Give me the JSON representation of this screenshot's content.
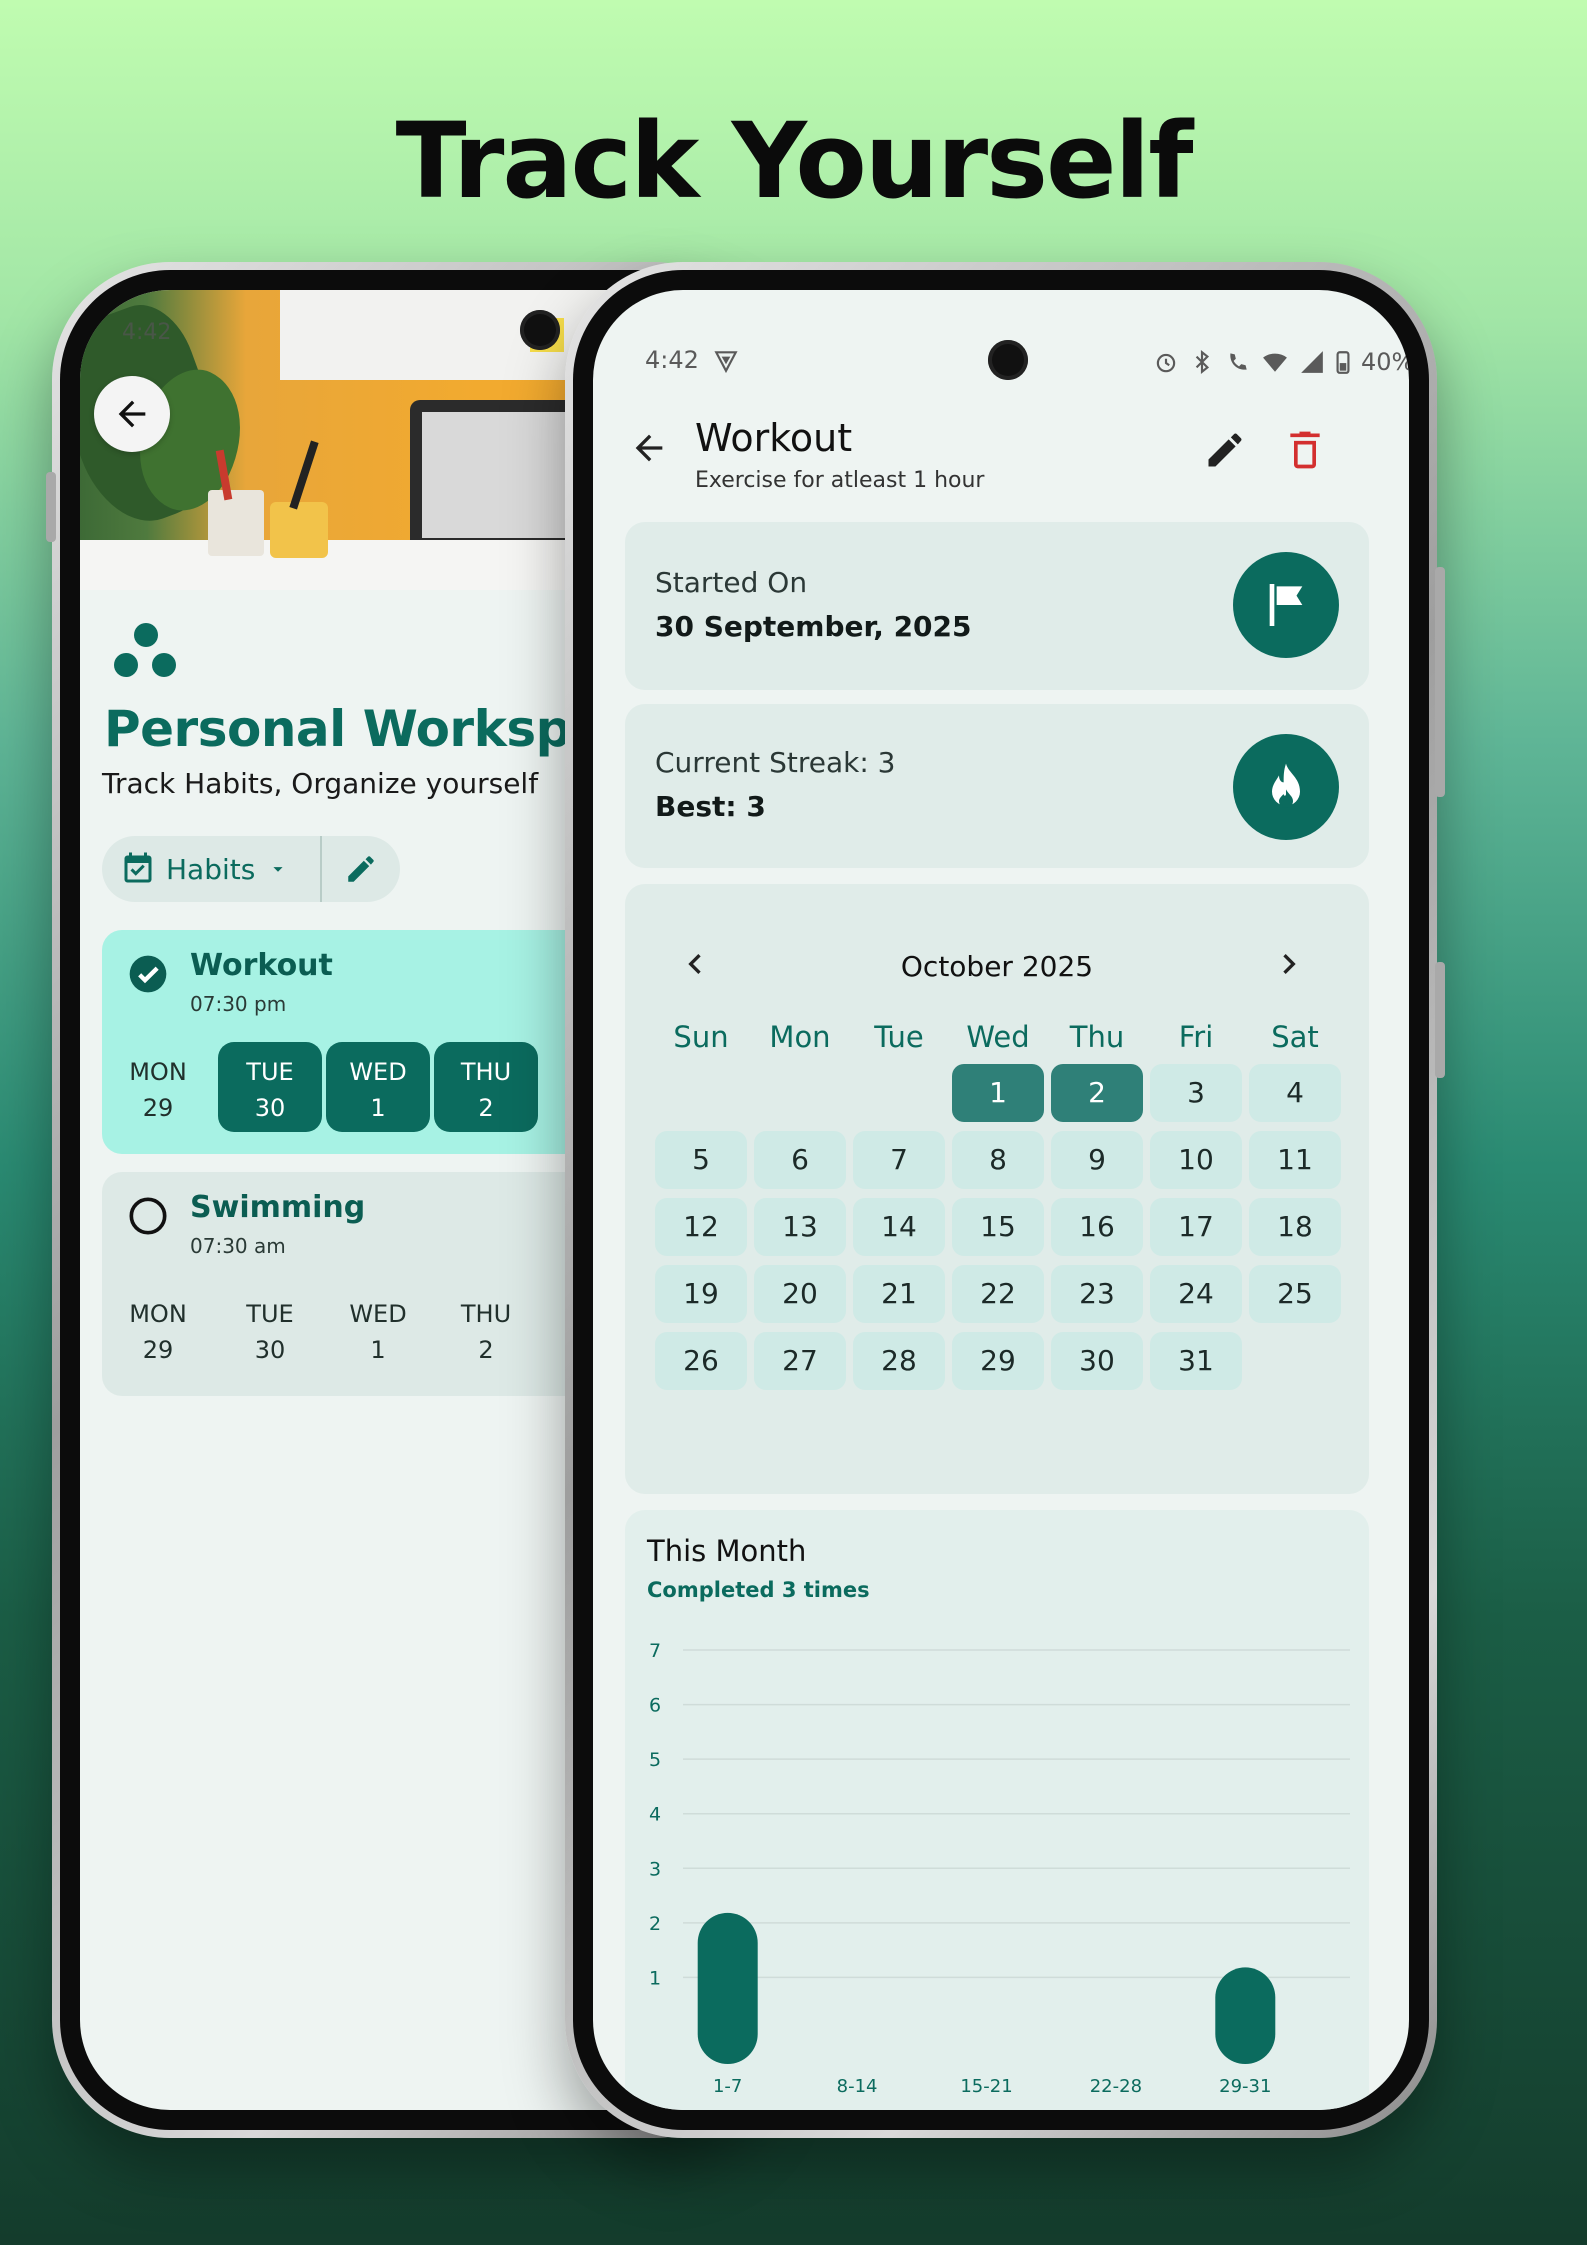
{
  "headline": "Track Yourself",
  "left": {
    "status_time": "4:42",
    "workspace_title": "Personal Workspa",
    "workspace_subtitle": "Track Habits, Organize yourself",
    "chip_label": "Habits",
    "habits": [
      {
        "name": "Workout",
        "time": "07:30 pm",
        "done": true,
        "days": [
          {
            "dow": "MON",
            "date": "29",
            "on": false
          },
          {
            "dow": "TUE",
            "date": "30",
            "on": true
          },
          {
            "dow": "WED",
            "date": "1",
            "on": true
          },
          {
            "dow": "THU",
            "date": "2",
            "on": true
          }
        ]
      },
      {
        "name": "Swimming",
        "time": "07:30 am",
        "done": false,
        "days": [
          {
            "dow": "MON",
            "date": "29",
            "on": false
          },
          {
            "dow": "TUE",
            "date": "30",
            "on": false
          },
          {
            "dow": "WED",
            "date": "1",
            "on": false
          },
          {
            "dow": "THU",
            "date": "2",
            "on": false
          }
        ]
      }
    ]
  },
  "right": {
    "status_time": "4:42",
    "battery": "40%",
    "title": "Workout",
    "subtitle": "Exercise for atleast 1 hour",
    "started_label": "Started On",
    "started_value": "30 September, 2025",
    "streak_label": "Current Streak: 3",
    "best_label": "Best: 3",
    "calendar": {
      "month": "October 2025",
      "weekdays": [
        "Sun",
        "Mon",
        "Tue",
        "Wed",
        "Thu",
        "Fri",
        "Sat"
      ],
      "first_weekday_index": 3,
      "days_in_month": 31,
      "selected": [
        1,
        2
      ]
    },
    "chart_title": "This Month",
    "chart_subtitle": "Completed 3 times"
  },
  "chart_data": {
    "type": "bar",
    "categories": [
      "1-7",
      "8-14",
      "15-21",
      "22-28",
      "29-31"
    ],
    "values": [
      2,
      0,
      0,
      0,
      1
    ],
    "title": "This Month",
    "ylim": [
      0,
      7
    ],
    "yticks": [
      1,
      2,
      3,
      4,
      5,
      6,
      7
    ],
    "grid": true,
    "color": "#0b6b5e"
  },
  "colors": {
    "accent": "#0b6b5e",
    "delete": "#d32f2f",
    "highlight_card": "#a7f2e4"
  }
}
